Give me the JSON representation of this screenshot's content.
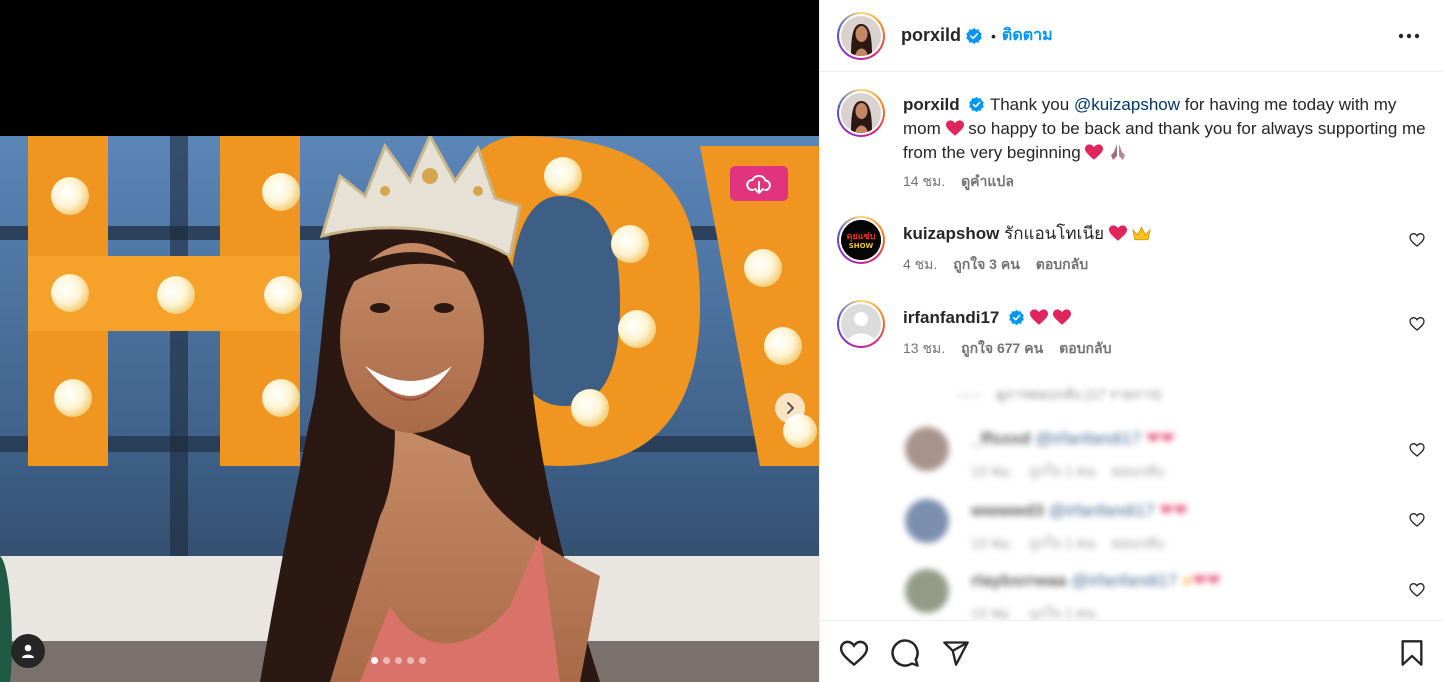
{
  "post": {
    "username": "porxild",
    "follow_label": "ติดตาม",
    "separator": "•",
    "caption": {
      "part1": "Thank you ",
      "mention": "@kuizapshow",
      "part2": " for having me today with my mom ",
      "part3": " so happy to be back and thank you for always supporting me from the very beginning ",
      "time": "14 ชม.",
      "translate": "ดูคำแปล"
    },
    "image": {
      "sign_letters": "HOW",
      "carousel_count": 5,
      "carousel_active": 1
    }
  },
  "comments": [
    {
      "username": "kuizapshow",
      "avatar_text": "คุยแซ่บ SHOW",
      "text": "รักแอนโทเนีย ",
      "time": "4 ชม.",
      "likes": "ถูกใจ 3 คน",
      "reply": "ตอบกลับ"
    },
    {
      "username": "irfanfandi17",
      "verified": true,
      "time": "13 ชม.",
      "likes": "ถูกใจ 677 คน",
      "reply": "ตอบกลับ"
    }
  ],
  "view_replies_label": "ดูการตอบกลับ (17 รายการ)",
  "replies": [
    {
      "username": "_ffsxxd",
      "mention": "@irfanfandi17",
      "time": "13 ชม.",
      "likes": "ถูกใจ 1 คน",
      "reply": "ตอบกลับ"
    },
    {
      "username": "wwwwd3",
      "mention": "@irfanfandi17",
      "time": "13 ชม.",
      "likes": "ถูกใจ 1 คน",
      "reply": "ตอบกลับ"
    },
    {
      "username": "rlaybsrrwaa",
      "mention": "@irfanfandi17",
      "time": "13 ชม.",
      "likes": "ถูกใจ 1 คน",
      "reply": "ตอบกลับ"
    }
  ],
  "icons": {
    "verified": "verified-badge-icon",
    "more": "more-options-icon",
    "like": "heart-icon",
    "comment": "comment-icon",
    "share": "share-icon",
    "save": "bookmark-icon",
    "download": "cloud-download-icon",
    "next": "chevron-right-icon",
    "tags": "user-icon"
  },
  "colors": {
    "link": "#0095f6",
    "mention": "#00376b",
    "download_button": "#e0357c",
    "heart_emoji": "#e0245e"
  }
}
